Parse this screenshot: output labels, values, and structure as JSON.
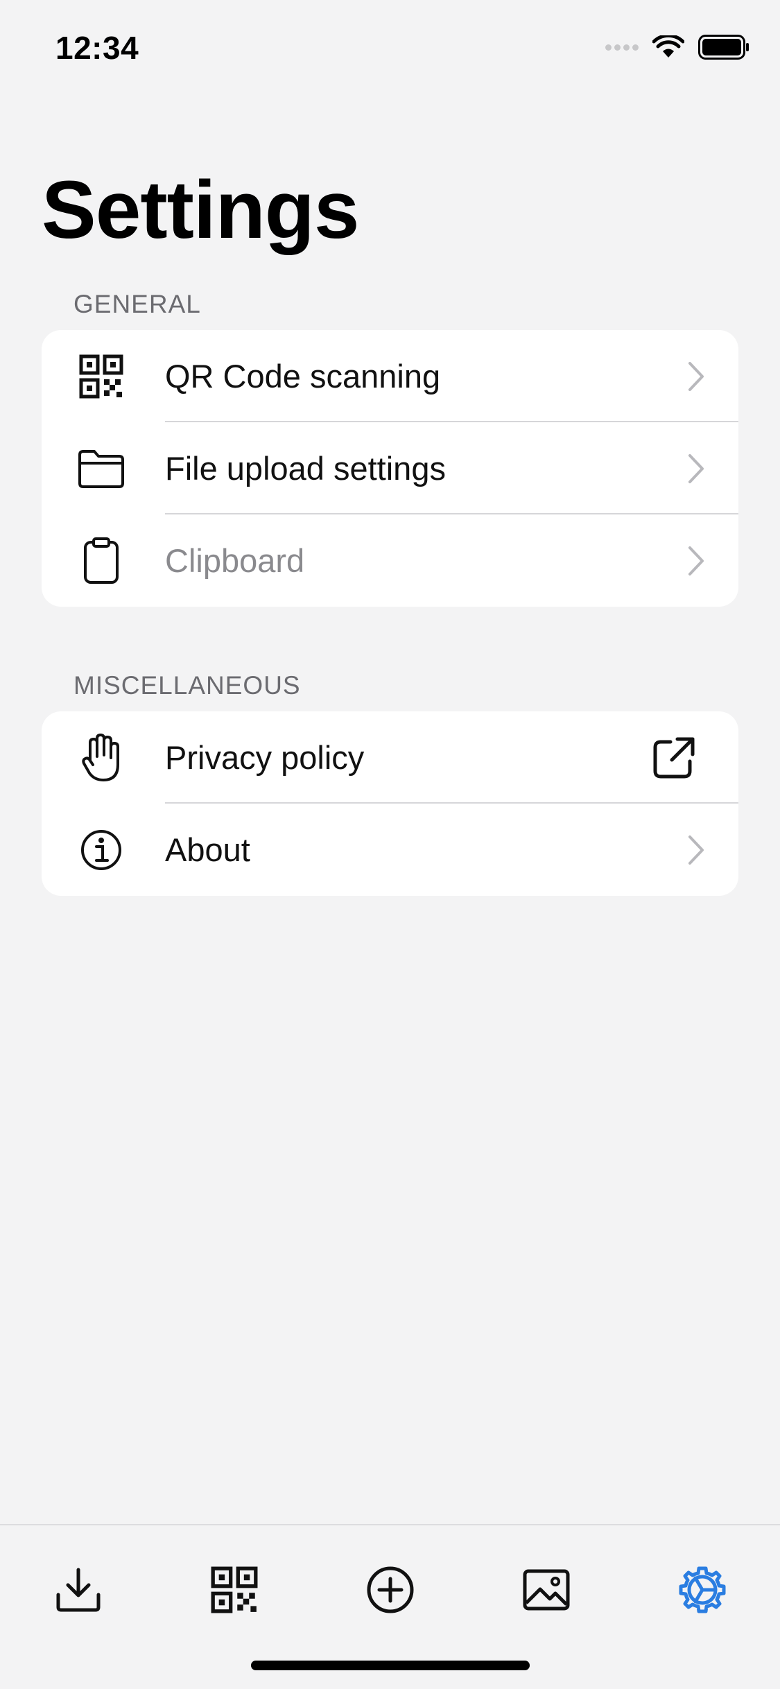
{
  "status_bar": {
    "time": "12:34"
  },
  "page": {
    "title": "Settings"
  },
  "sections": [
    {
      "header": "GENERAL",
      "rows": [
        {
          "label": "QR Code scanning",
          "icon": "qr-code-icon",
          "accessory": "chevron-right-icon",
          "disabled": false
        },
        {
          "label": "File upload settings",
          "icon": "folder-icon",
          "accessory": "chevron-right-icon",
          "disabled": false
        },
        {
          "label": "Clipboard",
          "icon": "clipboard-icon",
          "accessory": "chevron-right-icon",
          "disabled": true
        }
      ]
    },
    {
      "header": "MISCELLANEOUS",
      "rows": [
        {
          "label": "Privacy policy",
          "icon": "hand-icon",
          "accessory": "external-link-icon",
          "disabled": false
        },
        {
          "label": "About",
          "icon": "info-icon",
          "accessory": "chevron-right-icon",
          "disabled": false
        }
      ]
    }
  ],
  "tab_bar": {
    "tabs": [
      {
        "icon": "download-icon",
        "selected": false
      },
      {
        "icon": "qr-code-icon",
        "selected": false
      },
      {
        "icon": "add-circle-icon",
        "selected": false
      },
      {
        "icon": "image-icon",
        "selected": false
      },
      {
        "icon": "gear-icon",
        "selected": true
      }
    ]
  },
  "colors": {
    "background": "#f3f3f4",
    "card": "#ffffff",
    "accent": "#2a7de1",
    "section_header": "#6b6b70",
    "disabled_text": "#8a8a8e"
  }
}
